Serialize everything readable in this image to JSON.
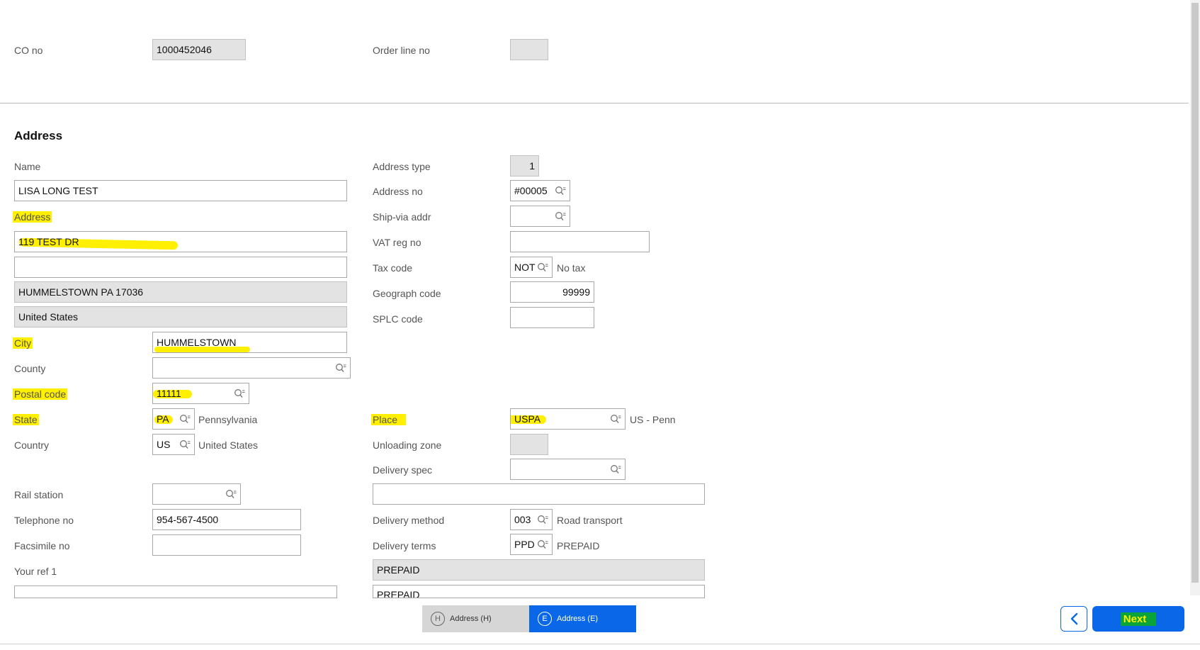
{
  "header": {
    "co_no_label": "CO no",
    "co_no_value": "1000452046",
    "order_line_label": "Order line no",
    "order_line_value": ""
  },
  "section": {
    "title": "Address"
  },
  "left": {
    "name_label": "Name",
    "name_value": "LISA LONG TEST",
    "address_label": "Address",
    "address_line1": "119 TEST DR",
    "address_line2": "",
    "address_line3": "HUMMELSTOWN PA 17036",
    "address_line4": "United States",
    "city_label": "City",
    "city_value": "HUMMELSTOWN",
    "county_label": "County",
    "county_value": "",
    "postal_label": "Postal code",
    "postal_value": "11111",
    "state_label": "State",
    "state_value": "PA",
    "state_desc": "Pennsylvania",
    "country_label": "Country",
    "country_value": "US",
    "country_desc": "United States",
    "rail_label": "Rail station",
    "rail_value": "",
    "tel_label": "Telephone no",
    "tel_value": "954-567-4500",
    "fax_label": "Facsimile no",
    "fax_value": "",
    "yourref_label": "Your ref 1",
    "yourref_value": ""
  },
  "right": {
    "addrtype_label": "Address type",
    "addrtype_value": "1",
    "addrno_label": "Address no",
    "addrno_value": "#00005",
    "shipvia_label": "Ship-via addr",
    "shipvia_value": "",
    "vat_label": "VAT reg no",
    "vat_value": "",
    "tax_label": "Tax code",
    "tax_value": "NOT",
    "tax_desc": "No tax",
    "geo_label": "Geograph code",
    "geo_value": "99999",
    "splc_label": "SPLC code",
    "splc_value": "",
    "place_label": "Place",
    "place_value": "USPA",
    "place_desc": "US - Penn",
    "unload_label": "Unloading zone",
    "unload_value": "",
    "delspec_label": "Delivery spec",
    "delspec_value": "",
    "delspec_text": "",
    "delmethod_label": "Delivery method",
    "delmethod_value": "003",
    "delmethod_desc": "Road transport",
    "delterms_label": "Delivery terms",
    "delterms_value": "PPD",
    "delterms_desc": "PREPAID",
    "delterms_text1": "PREPAID",
    "delterms_text2": "PREPAID"
  },
  "footer": {
    "tabs": [
      {
        "icon": "H",
        "label": "Address (H)"
      },
      {
        "icon": "E",
        "label": "Address (E)"
      }
    ],
    "next_label": "Next"
  },
  "colors": {
    "accent": "#0a68e8",
    "highlight": "#ffef00",
    "next_highlight": "#0aa53a"
  }
}
